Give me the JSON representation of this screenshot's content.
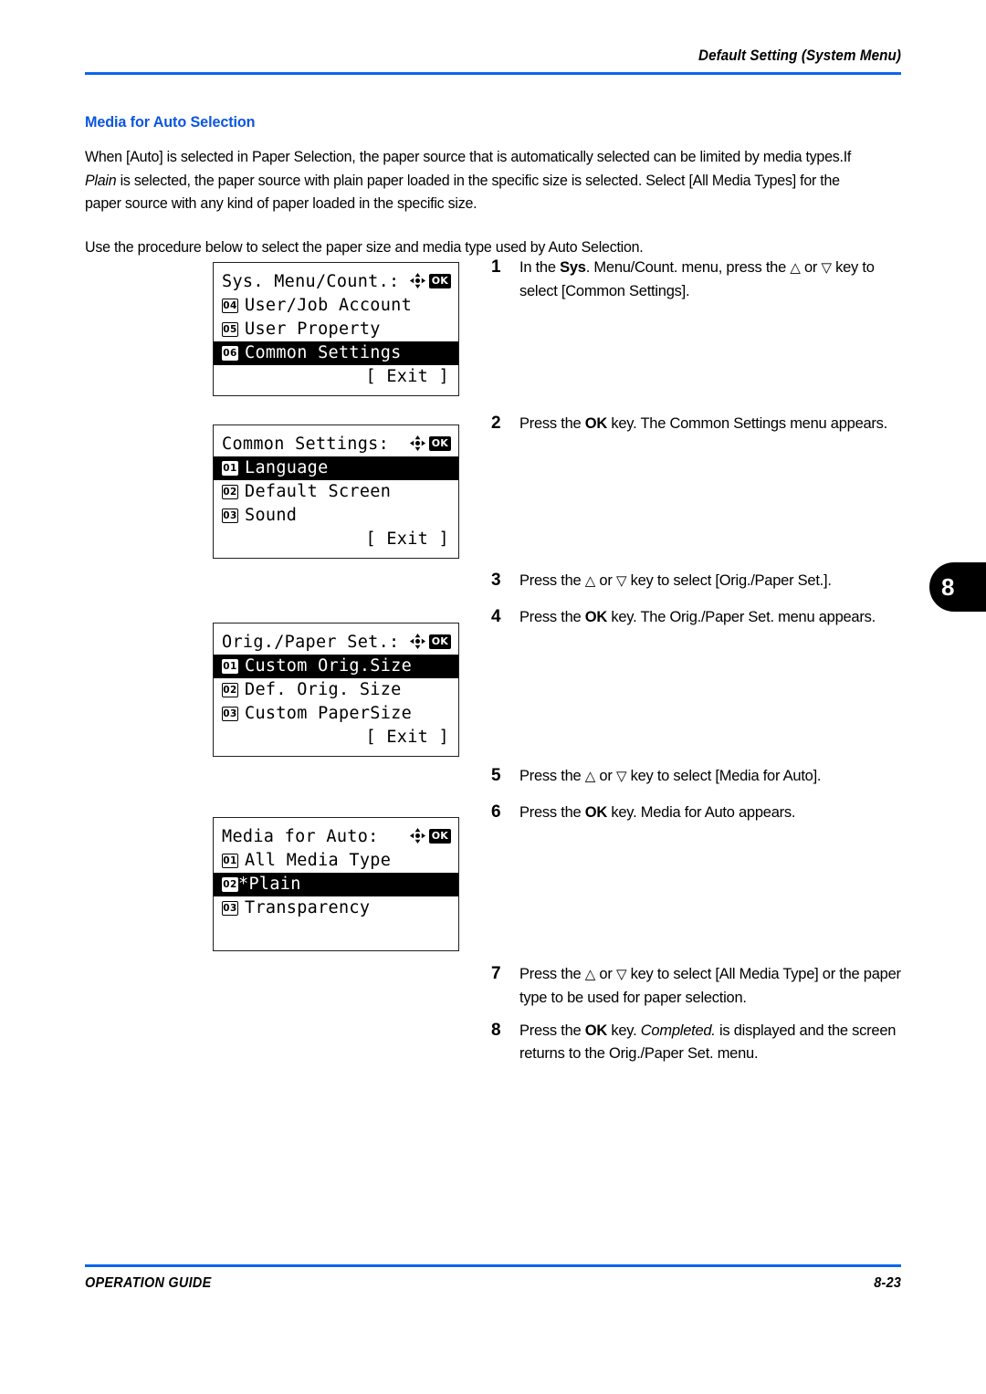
{
  "header": {
    "title": "Default Setting (System Menu)",
    "rule_color": "#0b65f0"
  },
  "section": {
    "heading": "Media for Auto Selection",
    "heading_color": "#0b55e0"
  },
  "intro": {
    "paragraph1_part1": "When [Auto] is selected in Paper Selection, the paper source that is automatically selected can be limited by media types.If ",
    "paragraph1_italic": "Plain",
    "paragraph1_part2": " is selected, the paper source with plain paper loaded in the specific size is selected. Select [All Media Types] for the paper source with any kind of paper loaded in the specific size.",
    "paragraph2": "Use the procedure below to select the paper size and media type used by Auto Selection."
  },
  "chapter_tab": {
    "number": "8"
  },
  "panels": [
    {
      "name": "sys-menu-count",
      "title": "Sys. Menu/Count.:",
      "icons": [
        "dpad-icon",
        "ok-icon"
      ],
      "rows": [
        {
          "badge": "04",
          "label": "User/Job Account",
          "selected": false
        },
        {
          "badge": "05",
          "label": "User Property",
          "selected": false
        },
        {
          "badge": "06",
          "label": "Common Settings",
          "selected": true
        }
      ],
      "exit": "[ Exit ]"
    },
    {
      "name": "common-settings",
      "title": "Common Settings:",
      "icons": [
        "dpad-icon",
        "ok-icon"
      ],
      "rows": [
        {
          "badge": "01",
          "label": "Language",
          "selected": true
        },
        {
          "badge": "02",
          "label": "Default Screen",
          "selected": false
        },
        {
          "badge": "03",
          "label": "Sound",
          "selected": false
        }
      ],
      "exit": "[ Exit ]"
    },
    {
      "name": "orig-paper-set",
      "title": "Orig./Paper Set.:",
      "icons": [
        "dpad-icon",
        "ok-icon"
      ],
      "rows": [
        {
          "badge": "01",
          "label": "Custom Orig.Size",
          "selected": true
        },
        {
          "badge": "02",
          "label": "Def. Orig. Size",
          "selected": false
        },
        {
          "badge": "03",
          "label": "Custom PaperSize",
          "selected": false
        }
      ],
      "exit": "[ Exit ]"
    },
    {
      "name": "media-for-auto",
      "title": "Media for Auto:",
      "icons": [
        "dpad-icon",
        "ok-icon"
      ],
      "rows": [
        {
          "badge": "01",
          "label": "All Media Type",
          "selected": false
        },
        {
          "badge": "02",
          "label": "*Plain",
          "selected": true,
          "tight": true
        },
        {
          "badge": "03",
          "label": "Transparency",
          "selected": false
        }
      ],
      "exit": ""
    }
  ],
  "steps": [
    {
      "number": "1",
      "text_1": "In the ",
      "bold_1": "Sys",
      "text_2": ". Menu/Count. menu, press the ",
      "tri_up": "△",
      "text_3": " or ",
      "tri_down": "▽",
      "text_4": " key to select [Common Settings]."
    },
    {
      "number": "2",
      "text_1": "Press the ",
      "bold_1": "OK",
      "text_2": " key. The Common Settings menu appears."
    },
    {
      "number": "3",
      "text_1": "Press the ",
      "tri_up": "△",
      "text_2": " or ",
      "tri_down": "▽",
      "text_3": " key to select [Orig./Paper Set.]."
    },
    {
      "number": "4",
      "text_1": "Press the ",
      "bold_1": "OK",
      "text_2": " key. The Orig./Paper Set. menu appears."
    },
    {
      "number": "5",
      "text_1": "Press the ",
      "tri_up": "△",
      "text_2": " or ",
      "tri_down": "▽",
      "text_3": " key to select [Media for Auto]."
    },
    {
      "number": "6",
      "text_1": "Press the ",
      "bold_1": "OK",
      "text_2": " key. Media for Auto appears."
    },
    {
      "number": "7",
      "text_1": "Press the ",
      "tri_up": "△",
      "text_2": " or ",
      "tri_down": "▽",
      "text_3": " key to select [All Media Type] or the paper type to be used for paper selection."
    },
    {
      "number": "8",
      "text_1": "Press the ",
      "bold_1": "OK",
      "text_2": " key. ",
      "italic_1": "Completed.",
      "text_3": " is displayed and the screen returns to the Orig./Paper Set. menu."
    }
  ],
  "footer": {
    "left": "OPERATION GUIDE",
    "right": "8-23"
  }
}
